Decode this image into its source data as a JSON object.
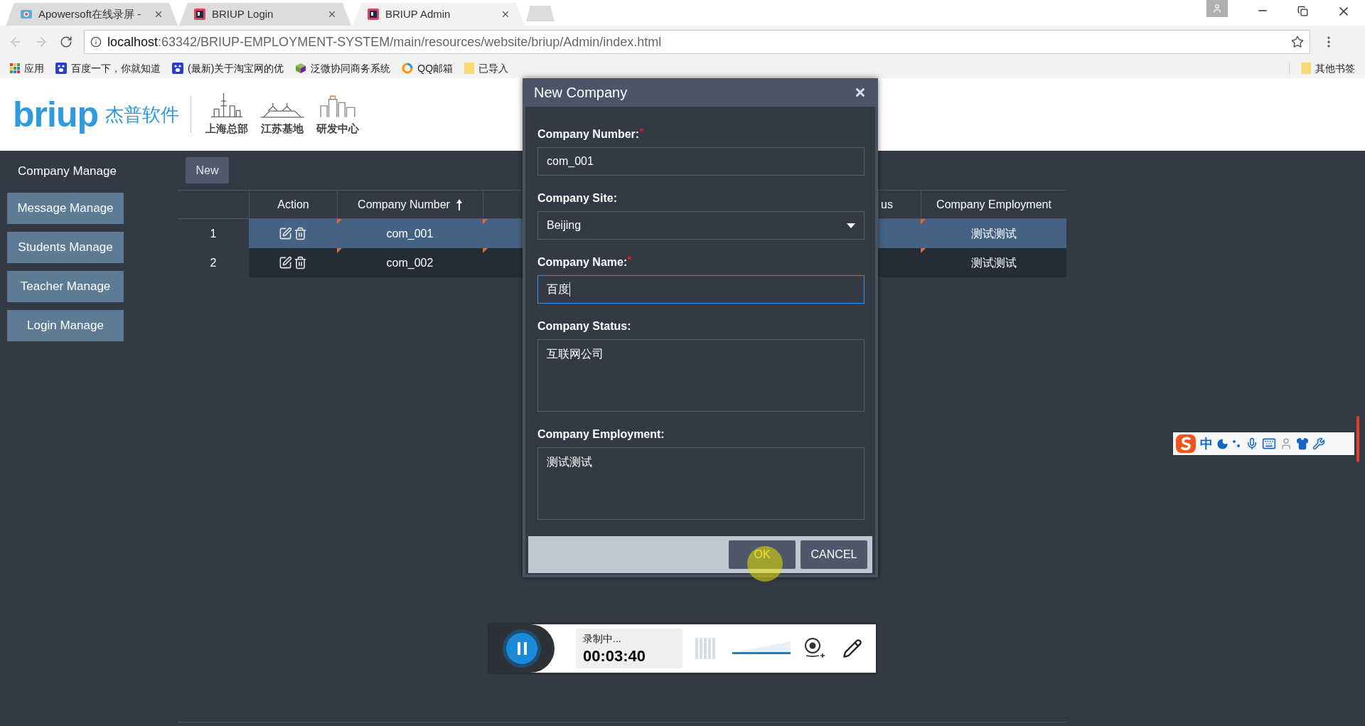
{
  "browser": {
    "tabs": [
      {
        "title": "Apowersoft在线录屏 -",
        "selected": false
      },
      {
        "title": "BRIUP Login",
        "selected": false
      },
      {
        "title": "BRIUP Admin",
        "selected": true
      }
    ],
    "url_host": "localhost",
    "url_path": ":63342/BRIUP-EMPLOYMENT-SYSTEM/main/resources/website/briup/Admin/index.html",
    "bookmarks": [
      "应用",
      "百度一下，你就知道",
      "(最新)关于淘宝网的优",
      "泛微协同商务系统",
      "QQ邮箱",
      "已导入"
    ],
    "other_bookmarks": "其他书签"
  },
  "header": {
    "logo": "briup",
    "logo_cn": "杰普软件",
    "sites": [
      "上海总部",
      "江苏基地",
      "研发中心"
    ]
  },
  "sidebar": {
    "title": "Company Manage",
    "items": [
      "Message Manage",
      "Students Manage",
      "Teacher Manage",
      "Login Manage"
    ]
  },
  "toolbar": {
    "new_button": "New"
  },
  "table": {
    "columns": [
      {
        "label": "Action",
        "sorted": false
      },
      {
        "label": "Company Number",
        "sorted": true
      },
      {
        "label": "us",
        "sorted": false
      },
      {
        "label": "Company Employment",
        "sorted": false
      }
    ],
    "rows": [
      {
        "index": "1",
        "selected": true,
        "company_number": "com_001",
        "company_employment": "测试测试"
      },
      {
        "index": "2",
        "selected": false,
        "company_number": "com_002",
        "company_employment": "测试测试"
      }
    ]
  },
  "dialog": {
    "title": "New Company",
    "fields": [
      {
        "label": "Company Number:",
        "required": true,
        "kind": "input",
        "value": "com_001",
        "focused": false
      },
      {
        "label": "Company Site:",
        "required": false,
        "kind": "select",
        "value": "Beijing",
        "focused": false
      },
      {
        "label": "Company Name:",
        "required": true,
        "kind": "input",
        "value": "百度",
        "focused": true
      },
      {
        "label": "Company Status:",
        "required": false,
        "kind": "textarea",
        "value": "互联网公司",
        "focused": false
      },
      {
        "label": "Company Employment:",
        "required": false,
        "kind": "textarea",
        "value": "测试测试",
        "focused": false
      }
    ],
    "ok_button": "OK",
    "cancel_button": "CANCEL"
  },
  "recorder": {
    "status": "录制中...",
    "time": "00:03:40",
    "level": 1
  },
  "ime": {
    "mode": "中"
  }
}
